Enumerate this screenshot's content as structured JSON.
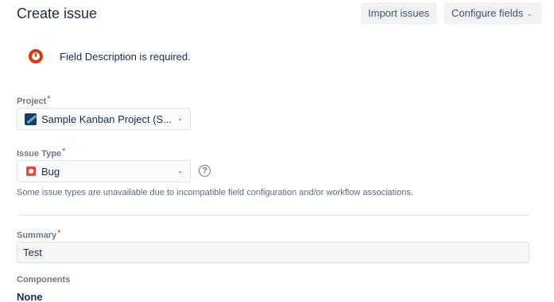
{
  "header": {
    "title": "Create issue",
    "import_label": "Import issues",
    "configure_label": "Configure fields",
    "configure_caret": "⌄"
  },
  "error": {
    "message": "Field Description is required."
  },
  "fields": {
    "project": {
      "label": "Project",
      "required_mark": "*",
      "value": "Sample Kanban Project (S...",
      "caret": "⌄",
      "icon": "project-avatar-icon"
    },
    "issue_type": {
      "label": "Issue Type",
      "required_mark": "*",
      "value": "Bug",
      "caret": "⌄",
      "icon": "bug-icon",
      "help_glyph": "?",
      "hint": "Some issue types are unavailable due to incompatible field configuration and/or workflow associations."
    },
    "summary": {
      "label": "Summary",
      "required_mark": "*",
      "value": "Test"
    },
    "components": {
      "label": "Components",
      "value": "None"
    }
  },
  "colors": {
    "error": "#de350b",
    "required": "#de350b",
    "bug": "#e5493a",
    "text": "#172b4d",
    "label": "#6b778c"
  }
}
